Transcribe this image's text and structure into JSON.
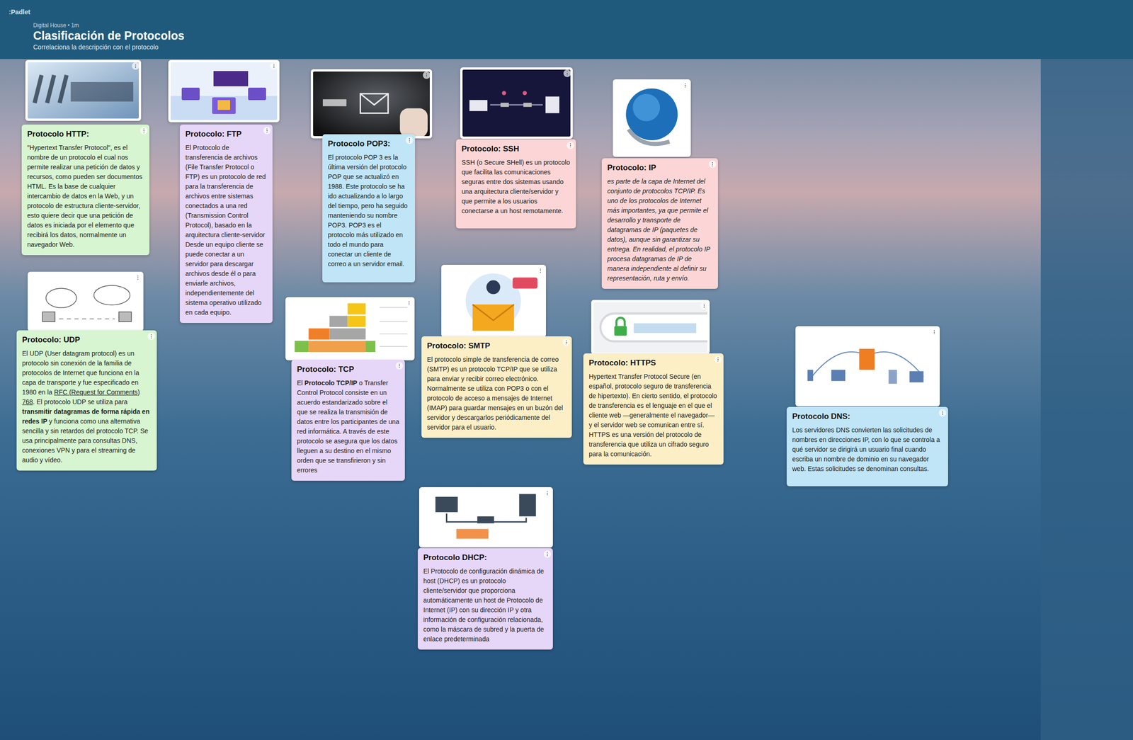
{
  "app": {
    "logo": ":Padlet"
  },
  "header": {
    "meta": "Digital House • 1m",
    "title": "Clasificación de Protocolos",
    "subtitle": "Correlaciona la descripción con el protocolo"
  },
  "cards": [
    {
      "kind": "http",
      "title": "Protocolo HTTP:",
      "color": "#d6f5d0",
      "italic": false,
      "body": [
        {
          "text": "\"Hypertext Transfer Protocol\", es el nombre de un protocolo el cual nos permite realizar una petición de datos y recursos, como pueden ser documentos HTML. Es la base de cualquier intercambio de datos en la Web, y un protocolo de estructura cliente-servidor, esto quiere decir que una petición de datos es iniciada por el elemento que recibirá los datos, normalmente un navegador Web.",
          "bold": false,
          "underline": false
        }
      ]
    },
    {
      "kind": "ftp",
      "title": "Protocolo: FTP",
      "color": "#e6d6f7",
      "italic": false,
      "body": [
        {
          "text": "El Protocolo de transferencia de archivos (File Transfer Protocol o FTP) es un protocolo de red para la transferencia de archivos entre sistemas conectados a una red (Transmission Control Protocol), basado en la arquitectura cliente-servidor Desde un equipo cliente se puede conectar a un servidor para descargar archivos desde él o para enviarle archivos, independientemente del sistema operativo utilizado en cada equipo.",
          "bold": false,
          "underline": false
        }
      ]
    },
    {
      "kind": "pop3",
      "title": "Protocolo POP3:",
      "color": "#bfe5f7",
      "italic": false,
      "body": [
        {
          "text": "El protocolo POP 3 es la última versión del protocolo POP que se actualizó en 1988. Este protocolo se ha ido actualizando a lo largo del tiempo, pero ha seguido manteniendo su nombre POP3. POP3 es el protocolo más utilizado en todo el mundo para conectar un cliente de correo a un servidor email.",
          "bold": false,
          "underline": false
        }
      ]
    },
    {
      "kind": "ssh",
      "title": "Protocolo: SSH",
      "color": "#fcd6d6",
      "italic": false,
      "body": [
        {
          "text": "SSH (o Secure SHell) es un protocolo que facilita las comunicaciones seguras entre dos sistemas usando una arquitectura cliente/servidor y que permite a los usuarios conectarse a un host remotamente.",
          "bold": false,
          "underline": false
        }
      ]
    },
    {
      "kind": "ip",
      "title": "Protocolo: IP",
      "color": "#fcd6d6",
      "italic": true,
      "body": [
        {
          "text": "es parte de la capa de Internet del conjunto de protocolos TCP/IP. Es uno de los protocolos de Internet más importantes, ya que permite el desarrollo y transporte de datagramas de IP (paquetes de datos), aunque sin garantizar su entrega. En realidad, el protocolo IP procesa datagramas de IP de manera independiente al definir su representación, ruta y envío.",
          "bold": false,
          "underline": false
        }
      ]
    },
    {
      "kind": "udp",
      "title": "Protocolo: UDP",
      "color": "#d6f5d0",
      "italic": false,
      "body": [
        {
          "text": "El UDP (User datagram protocol) es un protocolo sin conexión de la familia de protocolos de Internet que funciona en la capa de transporte y fue especificado en 1980 en la ",
          "bold": false,
          "underline": false
        },
        {
          "text": "RFC (Request for Comments) 768",
          "bold": false,
          "underline": true
        },
        {
          "text": ". El protocolo UDP se utiliza para ",
          "bold": false,
          "underline": false
        },
        {
          "text": "transmitir datagramas de forma rápida en redes IP",
          "bold": true,
          "underline": false
        },
        {
          "text": " y funciona como una alternativa sencilla y sin retardos del protocolo TCP. Se usa principalmente para consultas DNS, conexiones VPN y para el streaming de audio y vídeo.",
          "bold": false,
          "underline": false
        }
      ]
    },
    {
      "kind": "tcp",
      "title": "Protocolo: TCP",
      "color": "#e6d6f7",
      "italic": false,
      "body": [
        {
          "text": "El ",
          "bold": false,
          "underline": false
        },
        {
          "text": "Protocolo TCP/IP",
          "bold": true,
          "underline": false
        },
        {
          "text": " o Transfer Control Protocol consiste en un acuerdo estandarizado sobre el que se realiza la transmisión de datos entre los participantes de una red informática. A través de este protocolo se asegura que los datos lleguen a su destino en el mismo orden que se transfirieron y sin errores",
          "bold": false,
          "underline": false
        }
      ]
    },
    {
      "kind": "smtp",
      "title": "Protocolo: SMTP",
      "color": "#fcefc6",
      "italic": false,
      "body": [
        {
          "text": "El protocolo simple de transferencia de correo (SMTP) es un protocolo TCP/IP que se utiliza para enviar y recibir correo electrónico. Normalmente se utiliza con POP3 o con el protocolo de acceso a mensajes de Internet (IMAP) para guardar mensajes en un buzón del servidor y descargarlos periódicamente del servidor para el usuario.",
          "bold": false,
          "underline": false
        }
      ]
    },
    {
      "kind": "https",
      "title": "Protocolo: HTTPS",
      "color": "#fcefc6",
      "italic": false,
      "body": [
        {
          "text": " Hypertext Transfer Protocol Secure (en español, protocolo seguro de transferencia de hipertexto). En cierto sentido, el protocolo de transferencia es el lenguaje en el que el cliente web —generalmente el navegador— y el servidor web se comunican entre sí. HTTPS es una versión del protocolo de transferencia que utiliza un cifrado seguro para la comunicación.",
          "bold": false,
          "underline": false
        }
      ]
    },
    {
      "kind": "dns",
      "title": "Protocolo DNS:",
      "color": "#bfe5f7",
      "italic": false,
      "body": [
        {
          "text": "Los servidores DNS convierten las solicitudes de nombres en direcciones IP, con lo que se controla a qué servidor se dirigirá un usuario final cuando escriba un nombre de dominio en su navegador web. Estas solicitudes se denominan consultas.",
          "bold": false,
          "underline": false
        }
      ]
    },
    {
      "kind": "dhcp",
      "title": "Protocolo DHCP:",
      "color": "#e6d6f7",
      "italic": false,
      "body": [
        {
          "text": "El Protocolo de configuración dinámica de host (DHCP) es un protocolo cliente/servidor que proporciona automáticamente un host de Protocolo de Internet (IP) con su dirección IP y otra información de configuración relacionada, como la máscara de subred y la puerta de enlace predeterminada",
          "bold": false,
          "underline": false
        }
      ]
    }
  ]
}
